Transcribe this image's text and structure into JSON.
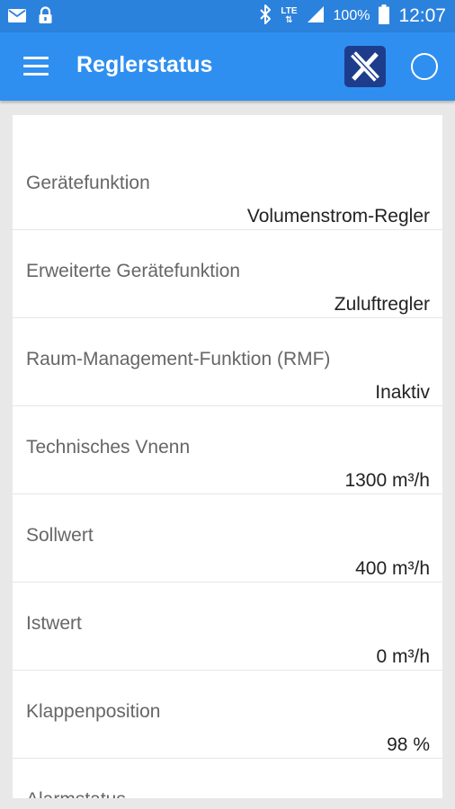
{
  "status_bar": {
    "icons": [
      "mail-icon",
      "lock-icon",
      "bluetooth-icon",
      "lte-icon",
      "signal-icon",
      "battery-icon"
    ],
    "lte_label": "LTE",
    "battery_percent": "100%",
    "time": "12:07"
  },
  "app_bar": {
    "title": "Reglerstatus",
    "menu_icon": "hamburger-menu-icon",
    "logo_icon": "x-logo-icon",
    "action_icon": "circle-icon"
  },
  "colors": {
    "status_bar": "#2b82dd",
    "app_bar": "#2f8ff0",
    "logo_bg": "#1d3d8c",
    "background": "#e8e8e8"
  },
  "status_items": [
    {
      "label": "Gerätefunktion",
      "value": "Volumenstrom-Regler"
    },
    {
      "label": "Erweiterte Gerätefunktion",
      "value": "Zuluftregler"
    },
    {
      "label": "Raum-Management-Funktion (RMF)",
      "value": "Inaktiv"
    },
    {
      "label": "Technisches Vnenn",
      "value": "1300 m³/h"
    },
    {
      "label": "Sollwert",
      "value": "400 m³/h"
    },
    {
      "label": "Istwert",
      "value": "0 m³/h"
    },
    {
      "label": "Klappenposition",
      "value": "98 %"
    },
    {
      "label": "Alarmstatus",
      "value": ""
    }
  ]
}
